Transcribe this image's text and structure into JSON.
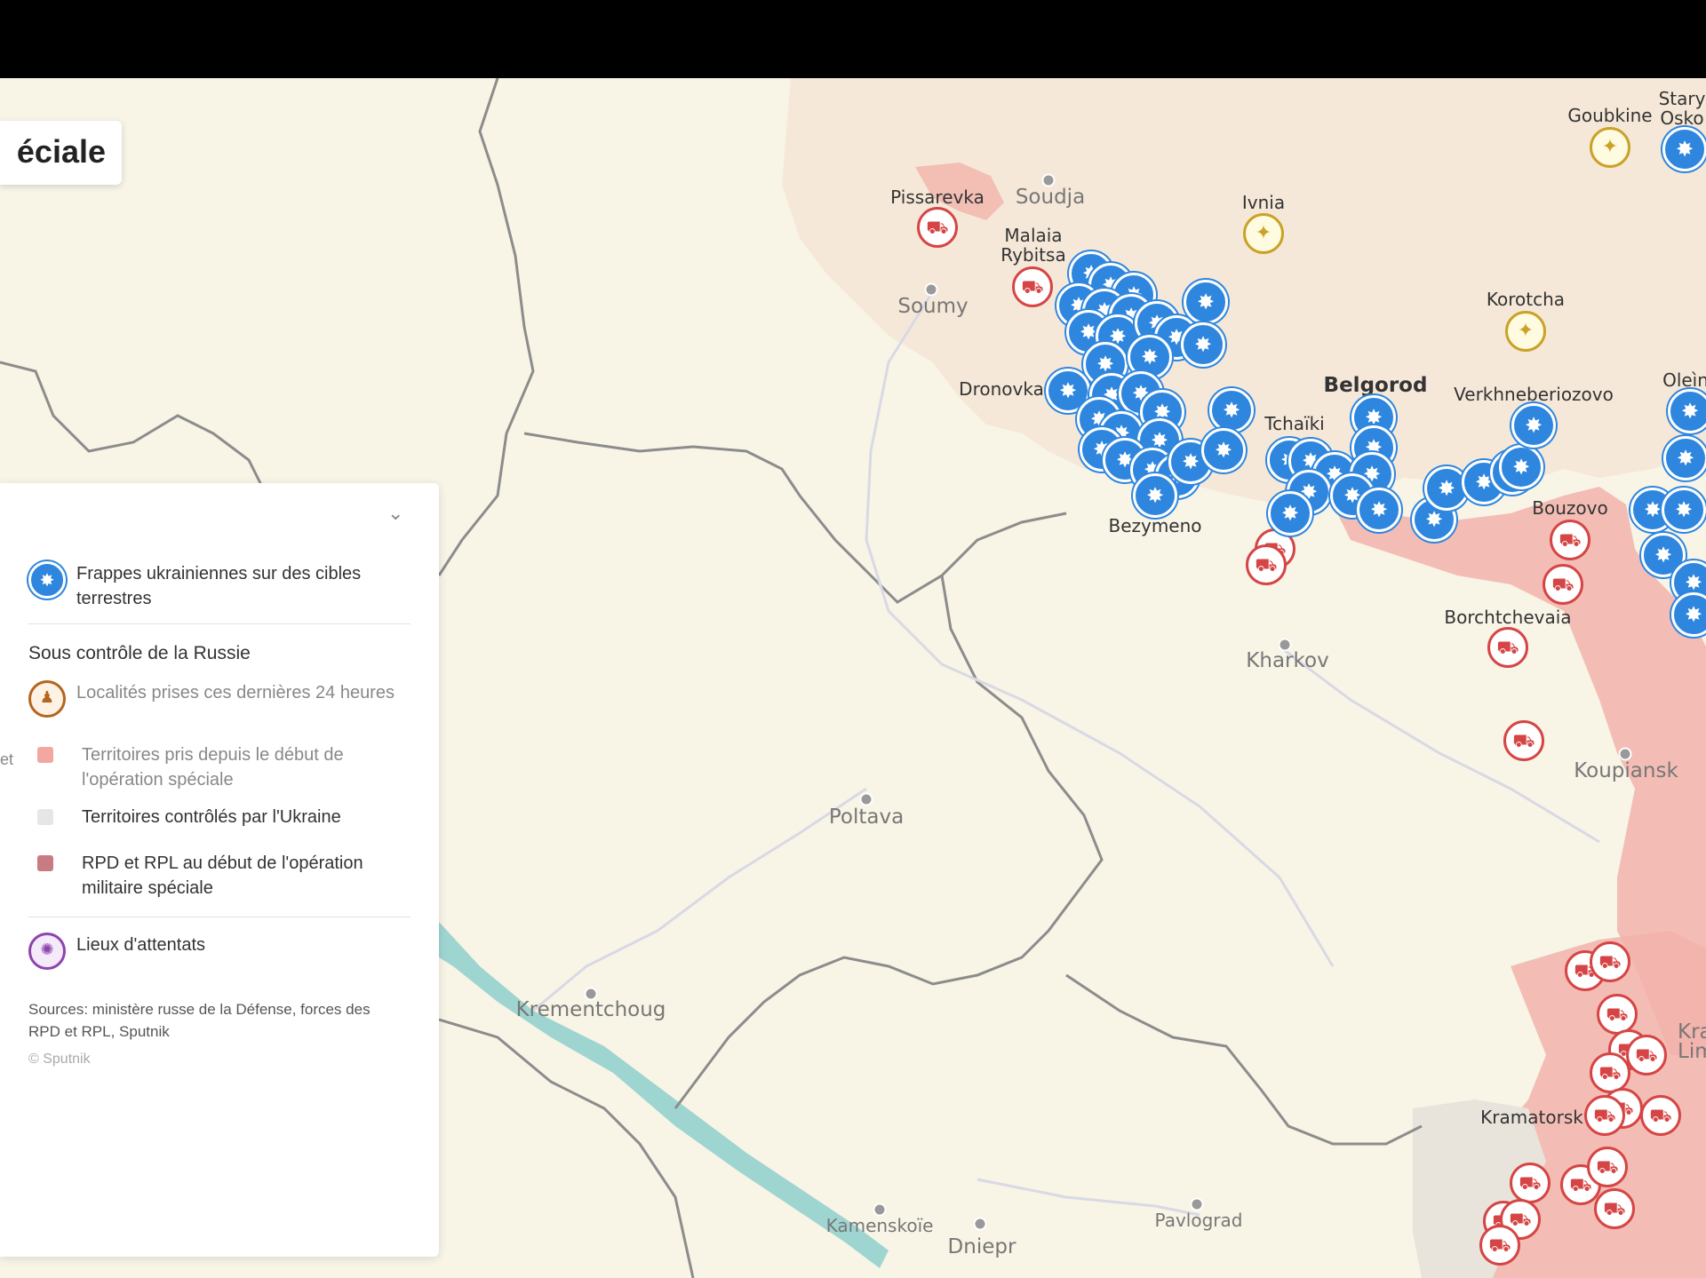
{
  "title": {
    "partial_text": "éciale"
  },
  "legend": {
    "items": [
      {
        "label": "Frappes ukrainiennes sur des cibles terrestres",
        "icon": "ukrainian-strike-icon",
        "color": "#2e86de"
      }
    ],
    "russia_heading": "Sous contrôle de la Russie",
    "russia_items": [
      {
        "label": "Localités prises ces dernières 24 heures",
        "icon": "captured-locality-icon",
        "color": "#b5651d"
      },
      {
        "label": "Territoires pris depuis le début de l'opération spéciale",
        "icon": "territory-taken-swatch",
        "color": "#f2a7a1"
      },
      {
        "label": "Territoires contrôlés par l'Ukraine",
        "icon": "ukraine-territory-swatch",
        "color": "#e6e6e6"
      },
      {
        "label": "RPD et RPL au début de l'opération militaire spéciale",
        "icon": "dpr-lpr-swatch",
        "color": "#c97b84"
      }
    ],
    "attack_item": {
      "label": "Lieux d'attentats",
      "icon": "attack-site-icon",
      "color": "#8e44ad"
    },
    "sources": "Sources: ministère russe de la Défense, forces des RPD et RPL, Sputnik",
    "copyright": "© Sputnik",
    "cut_text": "et"
  },
  "cities": {
    "pissarevka": "Pissarevka",
    "soudja": "Soudja",
    "malaia_rybitsa": "Malaia\nRybitsa",
    "soumy": "Soumy",
    "ivnia": "Ivnia",
    "goubkine": "Goubkine",
    "stary_oskol": "Stary\nOsko",
    "korotcha": "Korotcha",
    "dronovka": "Dronovka",
    "belgorod": "Belgorod",
    "verkhneberiozovo": "Verkhneberiozovo",
    "oleinik": "Oleìn",
    "tchaiki": "Tchaïki",
    "bezymeno": "Bezymeno",
    "bouzovo": "Bouzovo",
    "borchtchevaia": "Borchtchevaia",
    "kharkov": "Kharkov",
    "koupiansk": "Koupiansk",
    "poltava": "Poltava",
    "krementchoug": "Krementchoug",
    "krasny_liman": "Krasny\nLiman",
    "kramatorsk": "Kramatorsk",
    "kamenskoie": "Kamenskoïe",
    "dniepr": "Dniepr",
    "pavlograd": "Pavlograd"
  },
  "colors": {
    "land": "#f8f4e6",
    "russia": "#f6e8d8",
    "taken": "#f2b3ab",
    "ukraine_ctrl": "#e8e4dc",
    "water": "#9fd5d1",
    "strike": "#2e86de",
    "tank": "#d64545"
  }
}
